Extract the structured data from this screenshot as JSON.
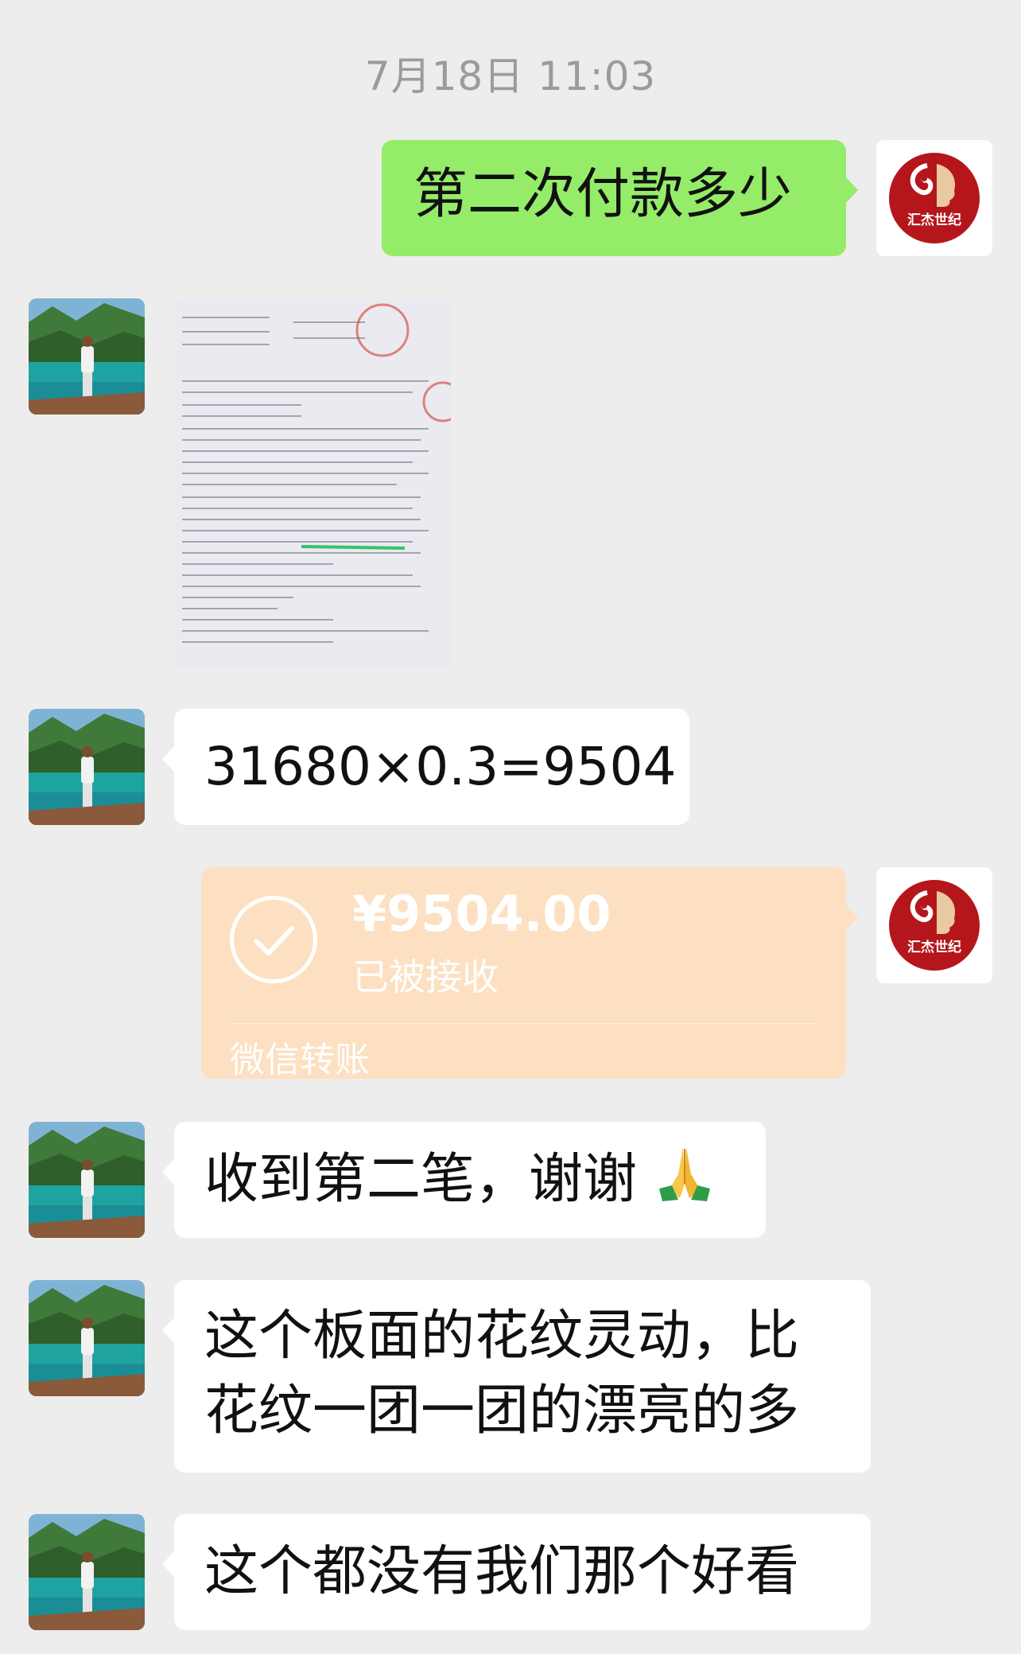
{
  "timestamp": "7月18日 11:03",
  "messages": {
    "m1": {
      "text": "第二次付款多少",
      "sender": "self"
    },
    "m2": {
      "type": "image",
      "sender": "contact",
      "image_desc": "contract-photo"
    },
    "m3": {
      "text": "31680×0.3=9504",
      "sender": "contact"
    },
    "m4": {
      "type": "transfer",
      "sender": "self",
      "amount": "¥9504.00",
      "status": "已被接收",
      "label": "微信转账"
    },
    "m5": {
      "text": "收到第二笔，谢谢",
      "sender": "contact",
      "emoji": "folded-hands"
    },
    "m6": {
      "line1": "这个板面的花纹灵动，比",
      "line2": "花纹一团一团的漂亮的多",
      "sender": "contact"
    },
    "m7": {
      "text": "这个都没有我们那个好看",
      "sender": "contact"
    }
  },
  "self_avatar": {
    "logo_text": "汇杰世纪",
    "logo_color": "#b5161b"
  },
  "colors": {
    "self_bubble": "#95ec69",
    "contact_bubble": "#ffffff",
    "transfer_bg": "#fce0c1",
    "background": "#ededed"
  }
}
